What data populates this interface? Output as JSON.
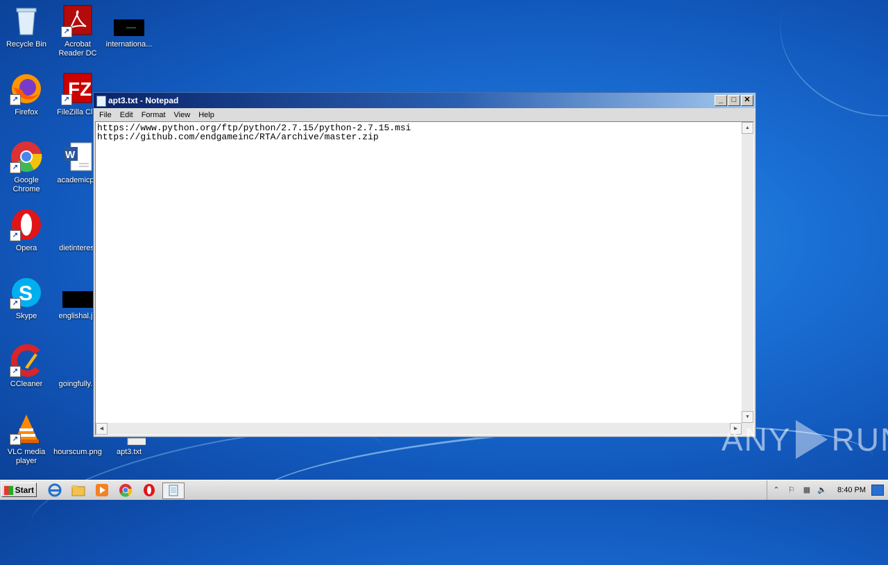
{
  "desktop": {
    "icons": [
      {
        "label": "Recycle Bin"
      },
      {
        "label": "Acrobat\nReader DC"
      },
      {
        "label": "internationa..."
      },
      {
        "label": "Firefox"
      },
      {
        "label": "FileZilla Clie"
      },
      {
        "label": "Google\nChrome"
      },
      {
        "label": "academicpo"
      },
      {
        "label": "Opera"
      },
      {
        "label": "dietinterest"
      },
      {
        "label": "Skype"
      },
      {
        "label": "englishal.jp"
      },
      {
        "label": "CCleaner"
      },
      {
        "label": "goingfully.p"
      },
      {
        "label": "VLC media\nplayer"
      },
      {
        "label": "hourscum.png"
      },
      {
        "label": "apt3.txt"
      }
    ]
  },
  "notepad": {
    "title": "apt3.txt - Notepad",
    "menu": [
      "File",
      "Edit",
      "Format",
      "View",
      "Help"
    ],
    "content": "https://www.python.org/ftp/python/2.7.15/python-2.7.15.msi\nhttps://github.com/endgameinc/RTA/archive/master.zip"
  },
  "watermark": {
    "left": "ANY",
    "right": "RUN"
  },
  "taskbar": {
    "start_label": "Start",
    "clock": "8:40 PM"
  }
}
